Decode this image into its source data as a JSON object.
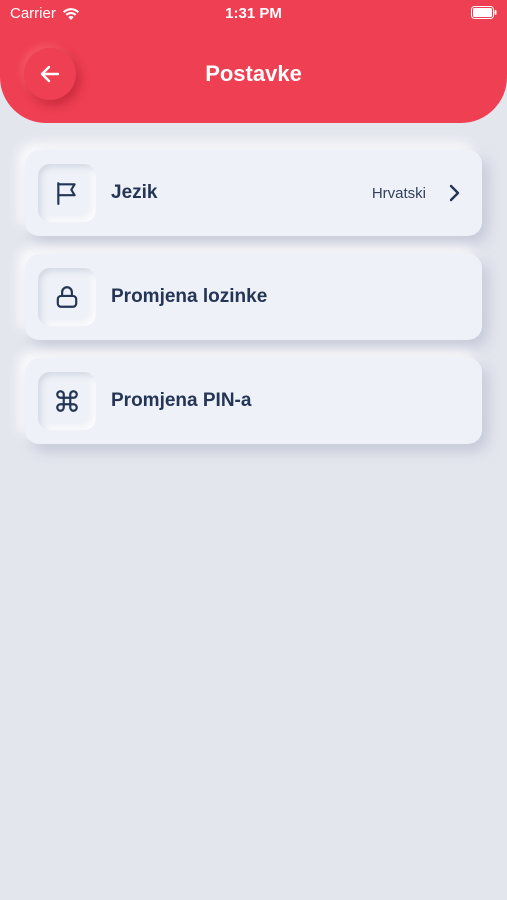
{
  "status_bar": {
    "carrier": "Carrier",
    "time": "1:31 PM"
  },
  "header": {
    "title": "Postavke",
    "back_icon": "arrow-left-icon"
  },
  "settings": [
    {
      "label": "Jezik",
      "value": "Hrvatski",
      "icon": "flag-icon",
      "has_chevron": true
    },
    {
      "label": "Promjena lozinke",
      "icon": "lock-icon"
    },
    {
      "label": "Promjena PIN-a",
      "icon": "command-icon"
    }
  ],
  "colors": {
    "accent": "#ef3f52",
    "background": "#e4e6ee",
    "card": "#eef1f7",
    "text": "#243556"
  }
}
